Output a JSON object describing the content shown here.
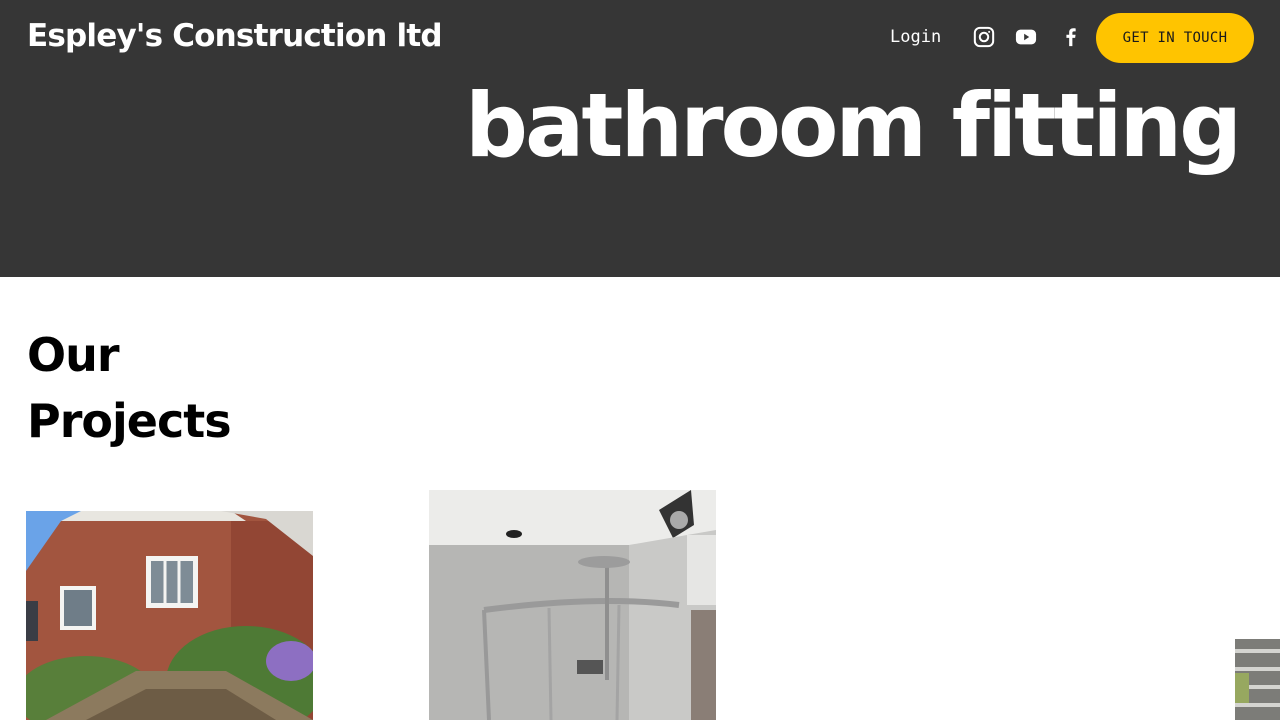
{
  "header": {
    "brand": "Espley's Construction ltd",
    "login_label": "Login",
    "social": [
      "instagram-icon",
      "youtube-icon",
      "facebook-icon"
    ],
    "cta_label": "GET IN TOUCH"
  },
  "hero": {
    "title": "bathroom fitting"
  },
  "projects": {
    "heading": "Our\nProjects",
    "items": [
      {
        "image": "brick-house-with-garden-shed"
      },
      {
        "image": "shower-enclosure-bathroom"
      },
      {
        "image": "building-exterior-partial"
      }
    ]
  },
  "colors": {
    "hero_bg": "#363636",
    "cta_bg": "#ffc400",
    "text_light": "#ffffff",
    "text_dark": "#000000"
  }
}
